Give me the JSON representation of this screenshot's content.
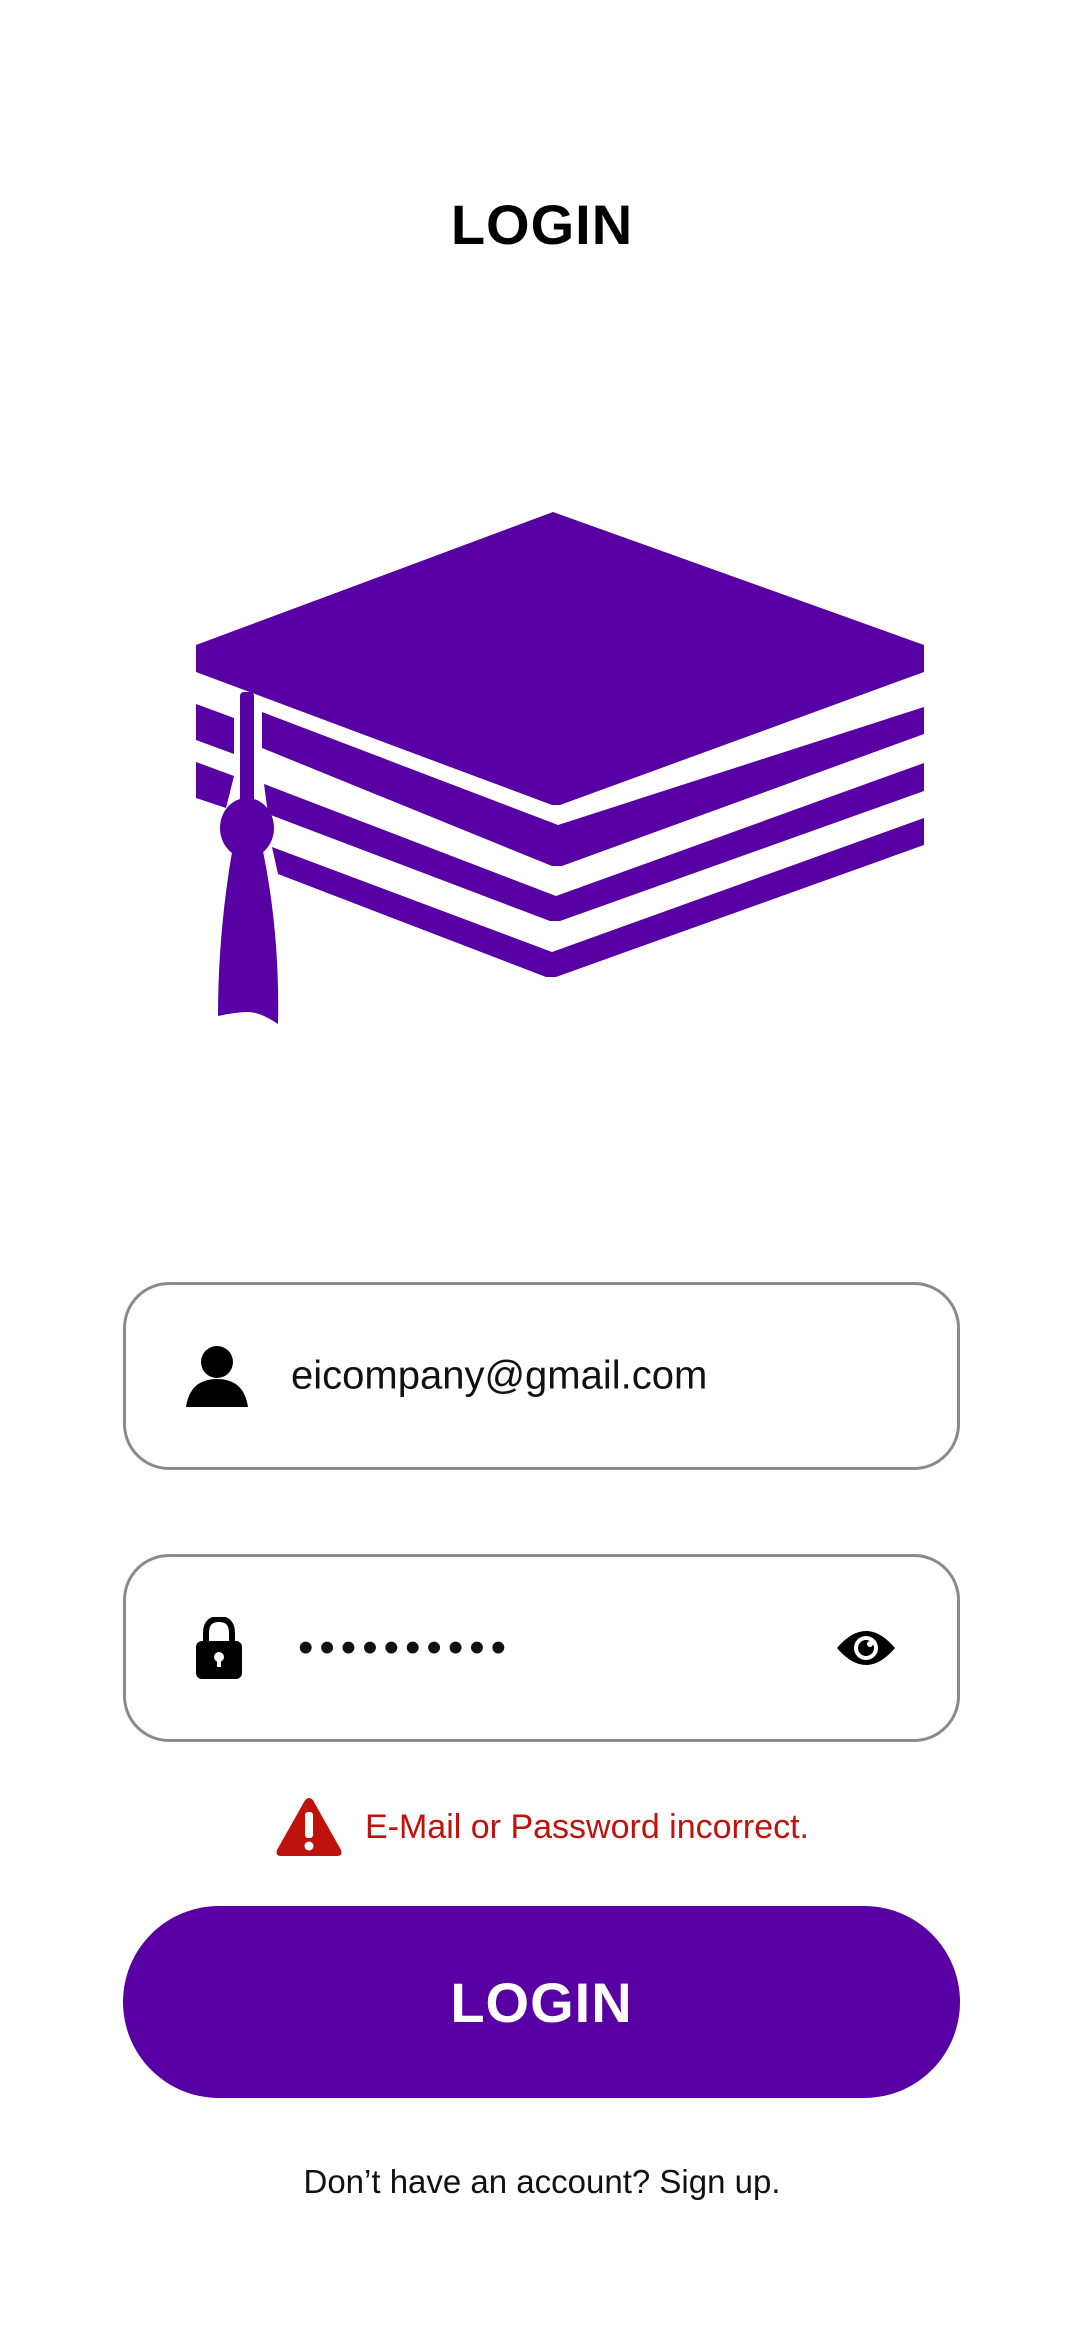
{
  "colors": {
    "brand": "#5800a4",
    "error": "#c0120c",
    "field_border": "#8a8a8a",
    "text": "#111111"
  },
  "header": {
    "title": "LOGIN"
  },
  "logo": {
    "icon": "graduation-cap-icon"
  },
  "email_field": {
    "icon": "user-icon",
    "value": "eicompany@gmail.com"
  },
  "password_field": {
    "icon": "lock-icon",
    "value": "••••••••••",
    "toggle_icon": "eye-icon"
  },
  "error": {
    "icon": "warning-icon",
    "message": "E-Mail or Password incorrect."
  },
  "login_button": {
    "label": "LOGIN"
  },
  "signup": {
    "text": "Don’t have an account? Sign up."
  }
}
